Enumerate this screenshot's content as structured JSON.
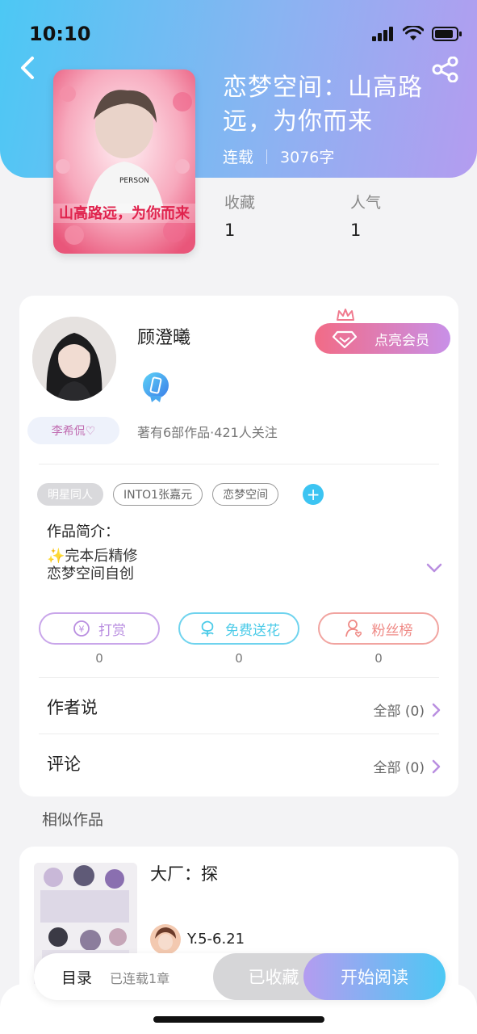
{
  "status_bar": {
    "time": "10:10"
  },
  "book": {
    "title": "恋梦空间：山高路远，为你而来",
    "status": "连载",
    "word_count": "3076字",
    "cover_text": "山高路远，为你而来",
    "stats": [
      {
        "label": "收藏",
        "value": "1"
      },
      {
        "label": "人气",
        "value": "1"
      }
    ]
  },
  "author": {
    "name": "顾澄曦",
    "tag": "李希侃♡",
    "stats": "著有6部作品·421人关注",
    "vip_label": "点亮会员"
  },
  "tags": {
    "items": [
      "明星同人",
      "INTO1张嘉元",
      "恋梦空间"
    ],
    "add": "+"
  },
  "intro": {
    "label": "作品简介：",
    "line1": "✨完本后精修",
    "line2": "恋梦空间自创"
  },
  "actions": [
    {
      "label": "打赏",
      "count": "0",
      "color": "#b98ee0"
    },
    {
      "label": "免费送花",
      "count": "0",
      "color": "#4ccbe8"
    },
    {
      "label": "粉丝榜",
      "count": "0",
      "color": "#ef8a86"
    }
  ],
  "rows": {
    "author_says": {
      "label": "作者说",
      "value": "全部 (0)"
    },
    "comments": {
      "label": "评论",
      "value": "全部 (0)"
    }
  },
  "similar": {
    "section_title": "相似作品",
    "items": [
      {
        "title": "大厂：探",
        "author": "Y.5-6.21"
      }
    ]
  },
  "bottom_bar": {
    "toc_label": "目录",
    "toc_count": "已连载1章",
    "collected_label": "已收藏",
    "read_label": "开始阅读"
  }
}
